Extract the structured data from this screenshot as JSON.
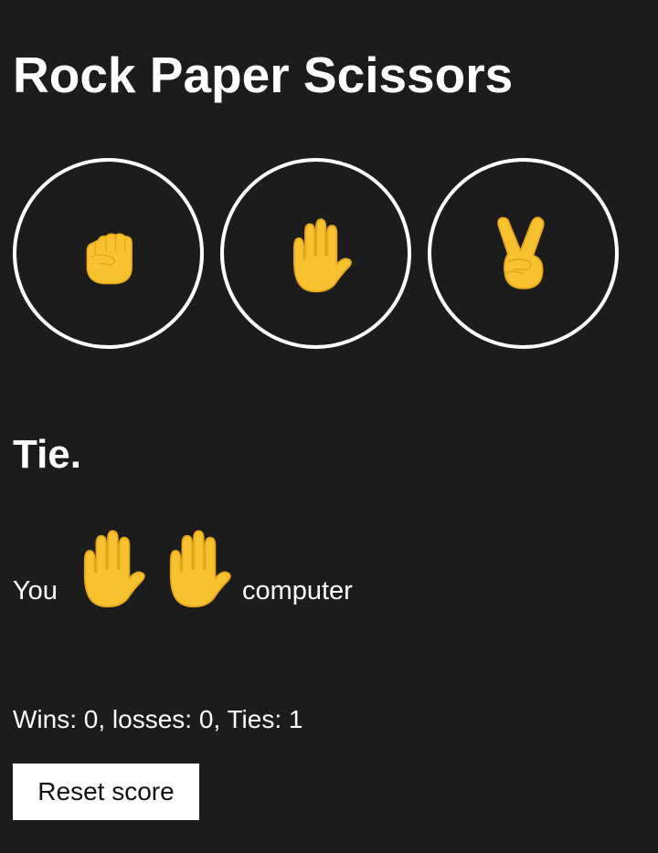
{
  "app": {
    "title": "Rock Paper Scissors"
  },
  "choices": [
    {
      "name": "rock",
      "icon": "raised-fist-icon"
    },
    {
      "name": "paper",
      "icon": "raised-hand-icon"
    },
    {
      "name": "scissors",
      "icon": "victory-hand-icon"
    }
  ],
  "result": {
    "text": "Tie.",
    "you_label": "You",
    "computer_label": "computer",
    "player_choice_icon": "raised-hand-icon",
    "computer_choice_icon": "raised-hand-icon"
  },
  "score": {
    "text": "Wins: 0, losses: 0, Ties: 1"
  },
  "reset_button": {
    "label": "Reset score"
  },
  "colors": {
    "background": "#1c1c1c",
    "text": "#ffffff",
    "emoji_yellow": "#f7c12f",
    "emoji_shade": "#e6a619"
  }
}
